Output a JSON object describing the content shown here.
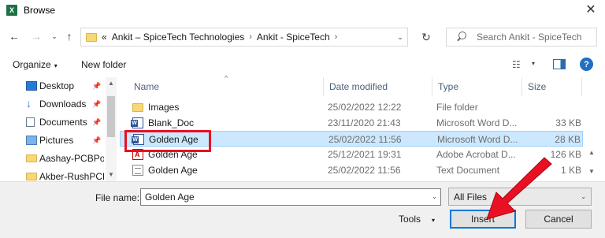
{
  "window": {
    "title": "Browse",
    "app_icon_letter": "X",
    "close_glyph": "✕"
  },
  "navigation": {
    "back_glyph": "←",
    "forward_glyph": "→",
    "recent_glyph": "⌄",
    "up_glyph": "↑",
    "breadcrumb": [
      {
        "label": "«"
      },
      {
        "label": "Ankit – SpiceTech Technologies"
      },
      {
        "label": "Ankit - SpiceTech"
      }
    ],
    "separator_glyph": "›",
    "dropdown_glyph": "⌄",
    "refresh_glyph": "↻",
    "search_placeholder": "Search Ankit - SpiceTech"
  },
  "toolbar": {
    "organize_label": "Organize",
    "organize_caret": "▾",
    "new_folder_label": "New folder",
    "view_glyph": "☷",
    "view_caret": "▾",
    "help_glyph": "?"
  },
  "sidebar": {
    "items": [
      {
        "label": "Desktop",
        "icon": "desktop-icon",
        "pinned": true
      },
      {
        "label": "Downloads",
        "icon": "download-icon",
        "pinned": true
      },
      {
        "label": "Documents",
        "icon": "documents-icon",
        "pinned": true
      },
      {
        "label": "Pictures",
        "icon": "pictures-icon",
        "pinned": true
      },
      {
        "label": "Aashay-PCBPow",
        "icon": "folder-icon",
        "pinned": false
      },
      {
        "label": "Akber-RushPCB-",
        "icon": "folder-icon",
        "pinned": false
      }
    ],
    "pin_glyph": "📌",
    "scroll_up_glyph": "▲",
    "scroll_down_glyph": "▼"
  },
  "filelist": {
    "columns": {
      "name": "Name",
      "date": "Date modified",
      "type": "Type",
      "size": "Size"
    },
    "sort_caret": "^",
    "rows": [
      {
        "name": "Images",
        "date": "25/02/2022 12:22",
        "type": "File folder",
        "size": "",
        "icon": "folder-icon",
        "selected": false
      },
      {
        "name": "Blank_Doc",
        "date": "23/11/2020 21:43",
        "type": "Microsoft Word D...",
        "size": "33 KB",
        "icon": "word-icon",
        "selected": false
      },
      {
        "name": "Golden Age",
        "date": "25/02/2022 11:56",
        "type": "Microsoft Word D...",
        "size": "28 KB",
        "icon": "word-icon",
        "selected": true
      },
      {
        "name": "Golden Age",
        "date": "25/12/2021 19:31",
        "type": "Adobe Acrobat D...",
        "size": "126 KB",
        "icon": "pdf-icon",
        "selected": false
      },
      {
        "name": "Golden Age",
        "date": "25/02/2022 11:56",
        "type": "Text Document",
        "size": "1 KB",
        "icon": "text-file-icon",
        "selected": false
      }
    ],
    "scroll_up_glyph": "▲",
    "scroll_down_glyph": "▼"
  },
  "footer": {
    "file_name_label": "File name:",
    "file_name_value": "Golden Age",
    "file_name_caret": "⌄",
    "filter_value": "All Files",
    "filter_caret": "⌄",
    "tools_label": "Tools",
    "tools_caret": "▾",
    "insert_label": "Insert",
    "cancel_label": "Cancel"
  },
  "colors": {
    "selection_bg": "#cce8ff",
    "highlight_box": "#e81123",
    "annotation_arrow": "#e81123",
    "default_button_border": "#0078d7"
  }
}
